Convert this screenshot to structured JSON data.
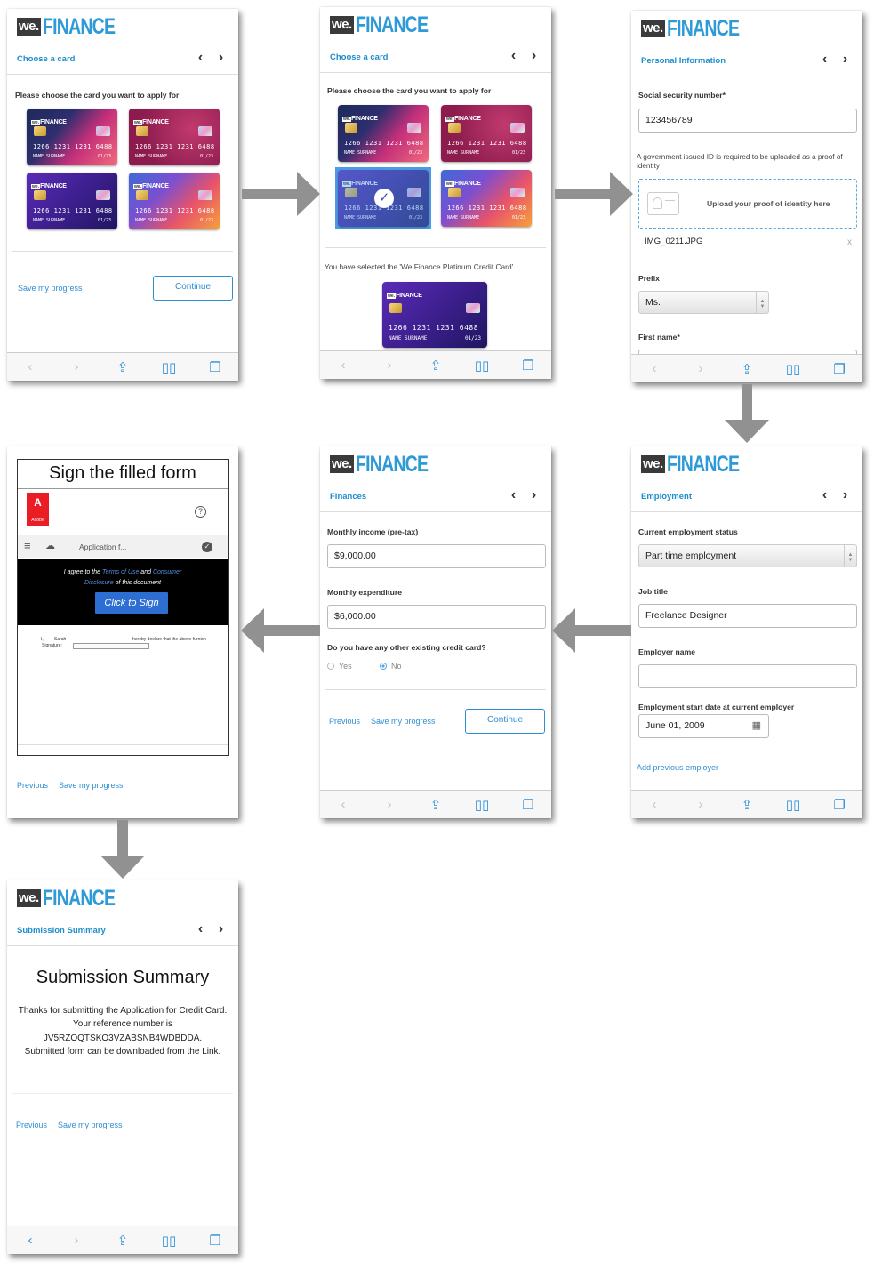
{
  "brand": {
    "we": "we.",
    "finance": "FINANCE"
  },
  "nav": {
    "prev": "‹",
    "next": "›"
  },
  "card": {
    "number": "1266 1231 1231 6488",
    "name": "NAME SURNAME",
    "expiry": "01/23"
  },
  "screen1": {
    "title": "Choose a card",
    "prompt": "Please choose the card you want to apply for",
    "save": "Save my progress",
    "continue": "Continue"
  },
  "screen2": {
    "title": "Choose a card",
    "prompt": "Please choose the card you want to apply for",
    "selected": "You have selected the 'We.Finance Platinum Credit Card'"
  },
  "screen3": {
    "title": "Personal Information",
    "ssn_label": "Social security number*",
    "ssn_value": "123456789",
    "id_note": "A government issued ID is required to be uploaded as a proof of identity",
    "upload": "Upload your proof of identity here",
    "file": "IMG_0211.JPG",
    "remove": "x",
    "prefix_label": "Prefix",
    "prefix_value": "Ms.",
    "first_name_label": "First name*"
  },
  "screen4": {
    "title": "Employment",
    "status_label": "Current employment status",
    "status_value": "Part time employment",
    "job_label": "Job title",
    "job_value": "Freelance Designer",
    "employer_label": "Employer name",
    "employer_value": "",
    "start_label": "Employment start date at current employer",
    "start_value": "June 01, 2009",
    "add_prev": "Add previous employer"
  },
  "screen5": {
    "title": "Finances",
    "income_label": "Monthly income (pre-tax)",
    "income_value": "$9,000.00",
    "expense_label": "Monthly expenditure",
    "expense_value": "$6,000.00",
    "card_q": "Do you have any other existing credit card?",
    "yes": "Yes",
    "no": "No",
    "previous": "Previous",
    "save": "Save my progress",
    "continue": "Continue"
  },
  "screen6": {
    "title": "Sign the filled form",
    "adobe": "Adobe",
    "app_title": "Application f...",
    "agree_1": "I agree to the",
    "terms": "Terms of Use",
    "and": "and",
    "consumer": "Consumer",
    "disclosure": "Disclosure",
    "of_doc": "of this document",
    "click_sign": "Click to Sign",
    "doc_i": "I,",
    "doc_name": "Sarah",
    "doc_declare": "hereby declare that the above-furnish",
    "doc_signature": "Signature:",
    "previous": "Previous",
    "save": "Save my progress"
  },
  "screen7": {
    "title": "Submission Summary",
    "heading": "Submission Summary",
    "line1": "Thanks for submitting the Application for Credit Card.",
    "line2": "Your reference number is",
    "ref": "JV5RZOQTSKO3VZABSNB4WDBDDA.",
    "line3": "Submitted form can be downloaded from the Link.",
    "previous": "Previous",
    "save": "Save my progress"
  }
}
